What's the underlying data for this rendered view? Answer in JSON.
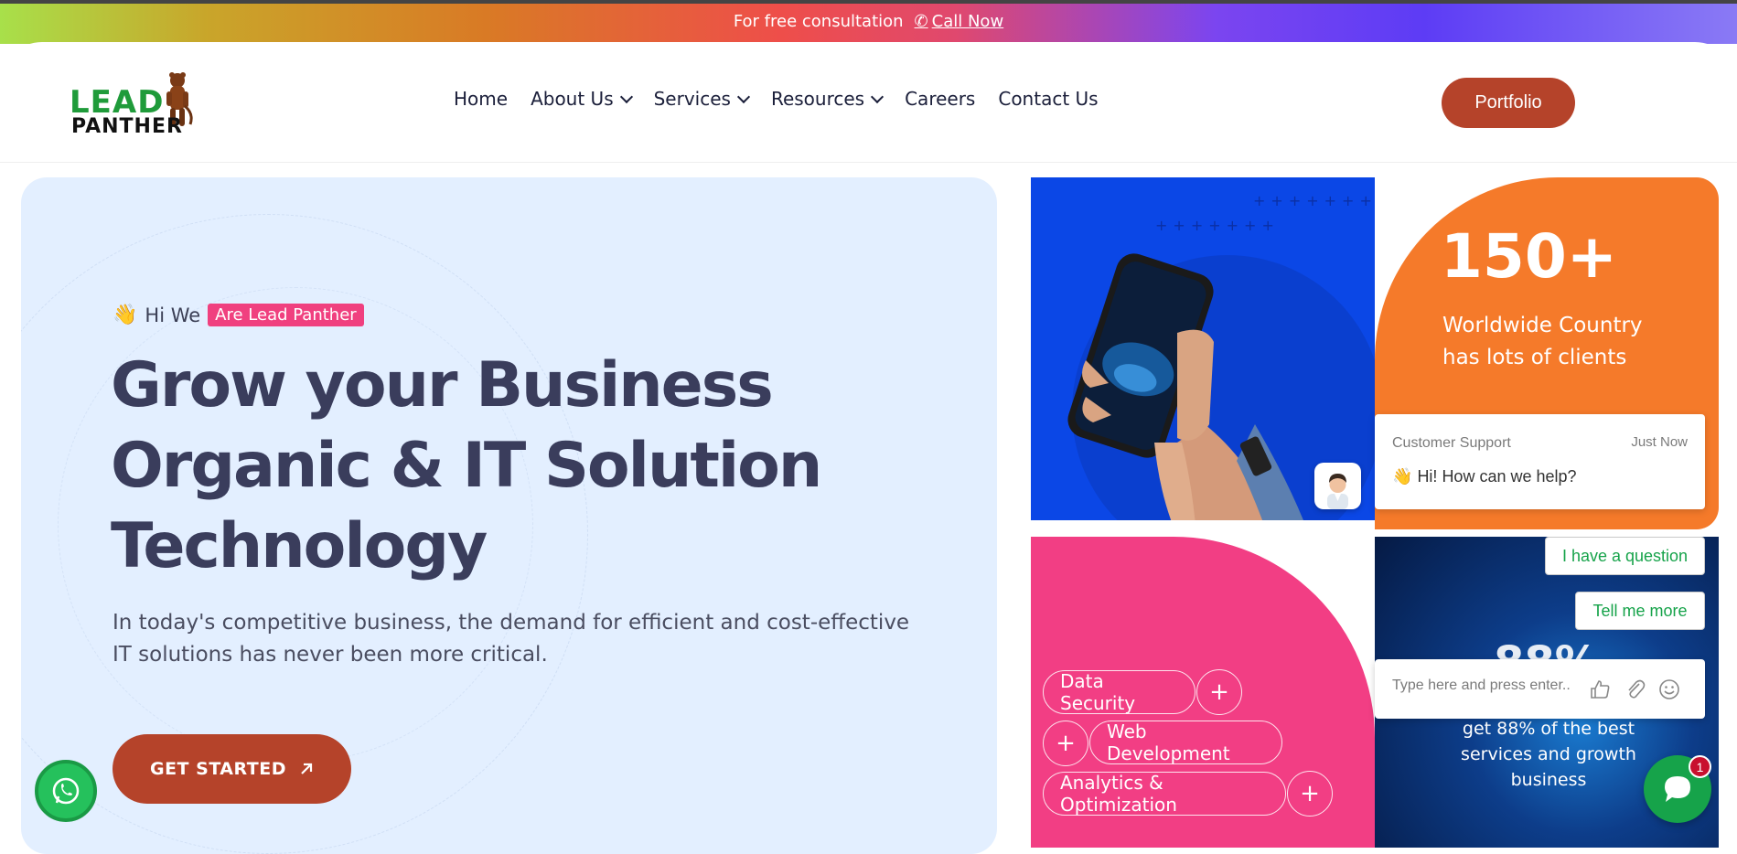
{
  "topbar": {
    "text": "For free consultation",
    "call_label": "Call Now"
  },
  "logo": {
    "line1": "LEAD",
    "line2": "PANTHER"
  },
  "nav": {
    "items": [
      {
        "label": "Home",
        "has_dropdown": false
      },
      {
        "label": "About Us",
        "has_dropdown": true
      },
      {
        "label": "Services",
        "has_dropdown": true
      },
      {
        "label": "Resources",
        "has_dropdown": true
      },
      {
        "label": "Careers",
        "has_dropdown": false
      },
      {
        "label": "Contact Us",
        "has_dropdown": false
      }
    ],
    "portfolio_label": "Portfolio"
  },
  "hero": {
    "greeting": "Hi We",
    "tag": "Are Lead Panther",
    "title_line1": "Grow your Business",
    "title_line2": "Organic & IT Solution",
    "title_line3": "Technology",
    "description": "In today's competitive business, the demand for efficient and cost-effective IT solutions has never been more critical.",
    "cta_label": "GET STARTED"
  },
  "stats": {
    "number": "150+",
    "label": "Worldwide Country has lots of clients"
  },
  "services": {
    "pills": [
      "Data Security",
      "Web Development",
      "Analytics & Optimization"
    ]
  },
  "dark_tile": {
    "number": "88%",
    "text": "get 88% of the best services and growth business"
  },
  "chat": {
    "agent_name": "Customer Support",
    "time": "Just Now",
    "message": "Hi! How can we help?",
    "quick_replies": [
      "I have a question",
      "Tell me more"
    ],
    "input_placeholder": "Type here and press enter..",
    "unread_count": "1"
  },
  "colors": {
    "brand_red": "#b5432a",
    "pink": "#f23e84",
    "orange": "#f57a2a",
    "blue": "#0b47e6",
    "chat_green": "#16a34a"
  }
}
